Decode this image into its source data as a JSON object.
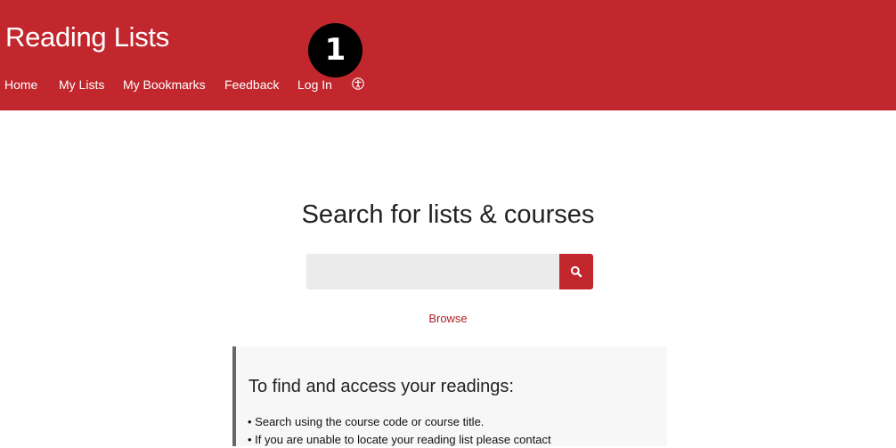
{
  "header": {
    "site_title": "Reading Lists",
    "bg_color": "#c1272d",
    "nav": [
      {
        "label": "Home"
      },
      {
        "label": "My Lists"
      },
      {
        "label": "My Bookmarks"
      },
      {
        "label": "Feedback"
      },
      {
        "label": "Log In"
      }
    ],
    "accessibility_icon": "accessibility-icon"
  },
  "badge": {
    "number": "1"
  },
  "search": {
    "heading": "Search for lists & courses",
    "input_value": "",
    "placeholder": "",
    "button_icon": "search-icon",
    "browse_label": "Browse"
  },
  "info": {
    "heading": "To find and access your readings:",
    "lines": [
      "• Search using the course code or course title.",
      "• If you are unable to locate your reading list please contact"
    ]
  }
}
